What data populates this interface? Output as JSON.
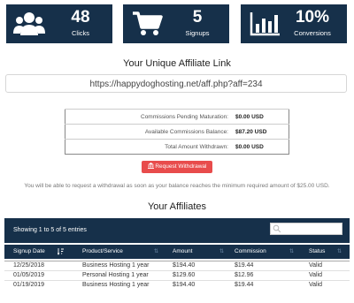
{
  "stats": [
    {
      "icon": "users-icon",
      "value": "48",
      "label": "Clicks"
    },
    {
      "icon": "shopping-cart-icon",
      "value": "5",
      "label": "Signups"
    },
    {
      "icon": "bar-chart-icon",
      "value": "10%",
      "label": "Conversions"
    }
  ],
  "affiliate_link": {
    "heading": "Your Unique Affiliate Link",
    "url": "https://happydoghosting.net/aff.php?aff=234"
  },
  "commissions": [
    {
      "label": "Commissions Pending Maturation:",
      "value": "$0.00 USD"
    },
    {
      "label": "Available Commissions Balance:",
      "value": "$87.20 USD"
    },
    {
      "label": "Total Amount Withdrawn:",
      "value": "$0.00 USD"
    }
  ],
  "withdraw_button": {
    "icon": "bank-icon",
    "label": "Request Withdrawal"
  },
  "min_note": "You will be able to request a withdrawal as soon as your balance reaches the minimum required amount of $25.00 USD.",
  "affiliates": {
    "heading": "Your Affiliates",
    "info": "Showing 1 to 5 of 5 entries",
    "search_placeholder": "",
    "columns": [
      "Signup Date",
      "Product/Service",
      "Amount",
      "Commission",
      "Status"
    ],
    "rows": [
      {
        "date": "12/25/2018",
        "product": "Business Hosting 1 year",
        "amount": "$194.40",
        "commission": "$19.44",
        "status": "Valid"
      },
      {
        "date": "01/05/2019",
        "product": "Personal Hosting 1 year",
        "amount": "$129.60",
        "commission": "$12.96",
        "status": "Valid"
      },
      {
        "date": "01/19/2019",
        "product": "Business Hosting 1 year",
        "amount": "$194.40",
        "commission": "$19.44",
        "status": "Valid"
      }
    ]
  },
  "colors": {
    "panel": "#16304a",
    "danger": "#e84c4c"
  }
}
